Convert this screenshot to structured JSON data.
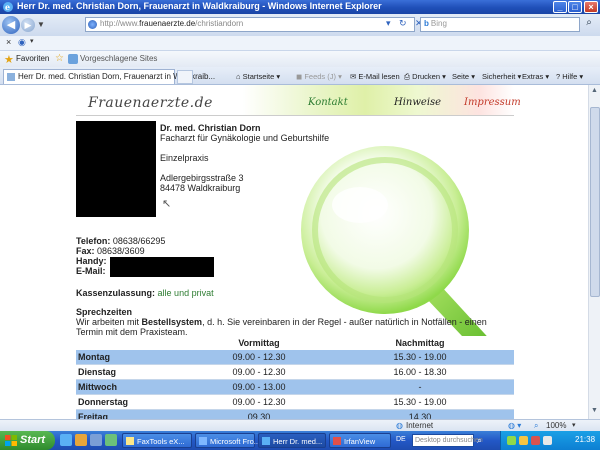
{
  "window": {
    "title": "Herr Dr. med. Christian Dorn, Frauenarzt in Waldkraiburg - Windows Internet Explorer"
  },
  "addressbar": {
    "url_prefix": "http://www.",
    "url_domain": "frauenaerzte.de",
    "url_path": "/christiandorn",
    "search_placeholder": "Bing"
  },
  "favorites": {
    "label": "Favoriten",
    "suggested": "Vorgeschlagene Sites"
  },
  "tab": {
    "label": "Herr Dr. med. Christian Dorn, Frauenarzt in Waldkraib..."
  },
  "commandbar": {
    "home": "Startseite",
    "feeds": "Feeds (J)",
    "email": "E-Mail lesen",
    "print": "Drucken",
    "page": "Seite",
    "safety": "Sicherheit",
    "extras": "Extras",
    "help": "Hilfe"
  },
  "site": {
    "logo": "Frauenaerzte.de",
    "nav": {
      "kontakt": "Kontakt",
      "hinweise": "Hinweise",
      "impressum": "Impressum"
    }
  },
  "doctor": {
    "name": "Dr. med. Christian Dorn",
    "specialty": "Facharzt für Gynäkologie und Geburtshilfe",
    "practice_type": "Einzelpraxis",
    "street": "Adlergebirgsstraße 3",
    "city": "84478 Waldkraiburg"
  },
  "contact": {
    "phone_label": "Telefon:",
    "phone": "08638/66295",
    "fax_label": "Fax:",
    "fax": "08638/3609",
    "mobile_label": "Handy:",
    "email_label": "E-Mail:",
    "insurance_label": "Kassenzulassung:",
    "insurance_value": "alle und privat"
  },
  "hours": {
    "heading": "Sprechzeiten",
    "intro_pre": "Wir arbeiten mit ",
    "intro_bold": "Bestellsystem",
    "intro_post": ", d. h. Sie vereinbaren in der Regel - außer natürlich in Notfällen - einen",
    "intro_line2": "Termin mit dem Praxisteam.",
    "col_morning": "Vormittag",
    "col_afternoon": "Nachmittag",
    "rows": [
      {
        "day": "Montag",
        "morning": "09.00 - 12.30",
        "afternoon": "15.30 - 19.00"
      },
      {
        "day": "Dienstag",
        "morning": "09.00 - 12.30",
        "afternoon": "16.00 - 18.30"
      },
      {
        "day": "Mittwoch",
        "morning": "09.00 - 13.00",
        "afternoon": "-"
      },
      {
        "day": "Donnerstag",
        "morning": "09.00 - 12.30",
        "afternoon": "15.30 - 19.00"
      },
      {
        "day": "Freitag",
        "morning": "09.30",
        "afternoon": "14.30"
      }
    ]
  },
  "statusbar": {
    "zone": "Internet",
    "zoom": "100%"
  },
  "taskbar": {
    "start": "Start",
    "items": [
      "FaxTools eX...",
      "Microsoft Fro...",
      "Herr Dr. med...",
      "IrfanView"
    ],
    "lang": "DE",
    "search_placeholder": "Desktop durchsuchen",
    "clock": "21:38"
  },
  "colors": {
    "accent_green": "#2e7d32",
    "impressum_red": "#c33a2a",
    "table_row_blue": "#9fc3ec",
    "taskbar_blue": "#2358c6"
  }
}
